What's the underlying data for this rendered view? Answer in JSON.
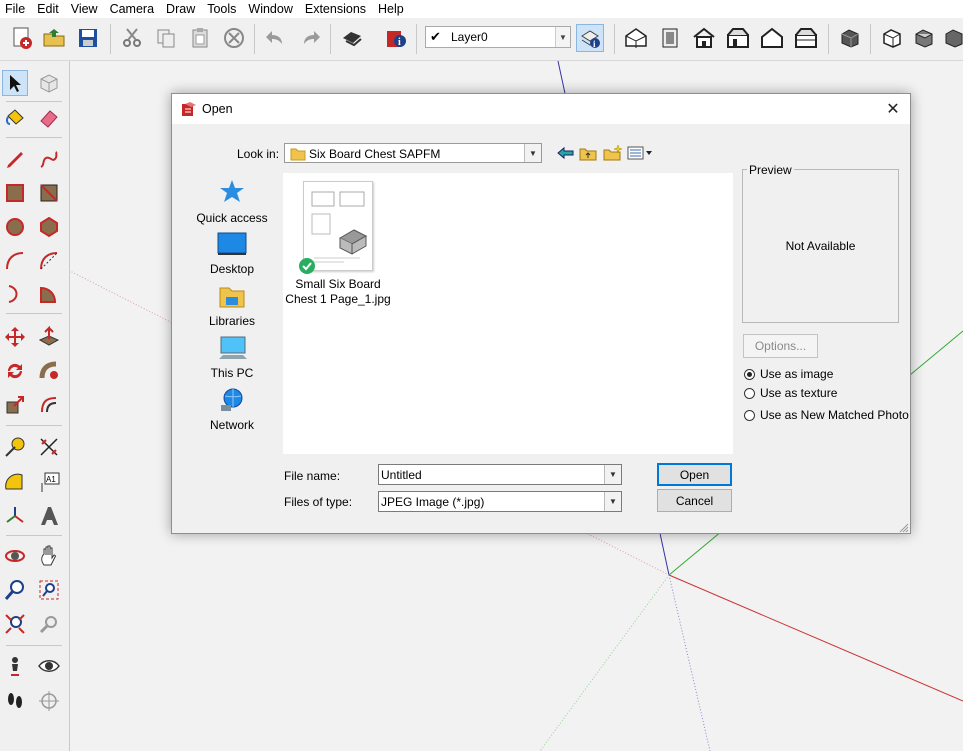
{
  "menu": [
    "File",
    "Edit",
    "View",
    "Camera",
    "Draw",
    "Tools",
    "Window",
    "Extensions",
    "Help"
  ],
  "toolbar": {
    "icons": [
      "new-model-icon",
      "open-folder-icon",
      "save-icon",
      "cut-icon",
      "copy-icon",
      "paste-icon",
      "erase-delete-icon",
      "undo-icon",
      "redo-icon",
      "print-icon",
      "model-info-icon",
      "iso-view-icon",
      "top-view-icon",
      "front-view-icon",
      "right-view-icon",
      "back-view-icon",
      "left-view-icon",
      "xray-style-icon",
      "wireframe-style-icon",
      "shaded-style-icon"
    ],
    "layer": {
      "name": "Layer0"
    }
  },
  "palette": {
    "tools": [
      "select-tool",
      "component-tool",
      "paint-bucket-tool",
      "eraser-tool",
      "pencil-tool",
      "freehand-tool",
      "rectangle-tool",
      "rotated-rectangle-tool",
      "circle-tool",
      "polygon-tool",
      "arc-tool",
      "pie-tool",
      "arc-2pt-tool",
      "arc-3pt-tool",
      "move-tool",
      "push-pull-tool",
      "rotate-tool",
      "follow-me-tool",
      "scale-tool",
      "offset-tool",
      "tape-measure-tool",
      "dimension-tool",
      "protractor-tool",
      "text-tool",
      "axes-tool",
      "3d-text-tool",
      "orbit-tool",
      "pan-tool",
      "zoom-tool",
      "zoom-window-tool",
      "zoom-extents-tool",
      "previous-view-tool",
      "position-camera-tool",
      "look-around-tool",
      "walk-tool",
      "section-plane-tool"
    ]
  },
  "dialog": {
    "title": "Open",
    "look_in_label": "Look in:",
    "look_in_value": "Six Board Chest SAPFM",
    "places": [
      {
        "label": "Quick access",
        "icon": "star-icon"
      },
      {
        "label": "Desktop",
        "icon": "desktop-icon"
      },
      {
        "label": "Libraries",
        "icon": "libraries-icon"
      },
      {
        "label": "This PC",
        "icon": "computer-icon"
      },
      {
        "label": "Network",
        "icon": "network-icon"
      }
    ],
    "files": [
      {
        "name_line1": "Small Six Board",
        "name_line2": "Chest 1 Page_1.jpg"
      }
    ],
    "preview_label": "Preview",
    "preview_text": "Not Available",
    "options_label": "Options...",
    "radios": [
      {
        "label": "Use as image",
        "checked": true
      },
      {
        "label": "Use as texture",
        "checked": false
      },
      {
        "label": "Use as New Matched Photo",
        "checked": false
      }
    ],
    "file_name_label": "File name:",
    "file_name_value": "Untitled",
    "file_type_label": "Files of type:",
    "file_type_value": "JPEG Image (*.jpg)",
    "open_label": "Open",
    "cancel_label": "Cancel"
  },
  "colors": {
    "axis_red": "#cc3333",
    "axis_green": "#33aa33",
    "axis_blue": "#3333aa",
    "accent": "#0078d7"
  }
}
